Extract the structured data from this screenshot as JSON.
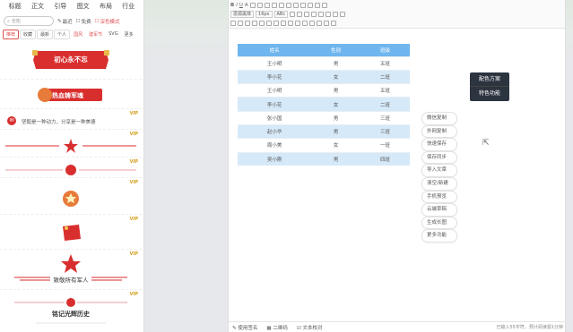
{
  "top_tabs": [
    "标题",
    "正文",
    "引导",
    "图文",
    "布局",
    "行业"
  ],
  "search": {
    "placeholder": "全拓",
    "opt1": "最近",
    "opt2": "免费",
    "opt3": "深色模式"
  },
  "filters": [
    "推荐",
    "收藏",
    "最新",
    "个人",
    "国风",
    "建军节",
    "SVG",
    "更多"
  ],
  "templates": {
    "t1": "初心永不忘",
    "t2": "热血铸军魂",
    "t3": "坚毅是一种动力，分享是一种美德",
    "t4": "致敬所有军人",
    "t5": "铭记光辉历史",
    "vip": "VIP"
  },
  "toolbar": {
    "font": "字体",
    "family": "思源黑体",
    "size": "16px",
    "size2": "ABc"
  },
  "table": {
    "headers": [
      "姓名",
      "性别",
      "班级"
    ],
    "rows": [
      [
        "王小明",
        "男",
        "五班"
      ],
      [
        "李小花",
        "女",
        "二班"
      ],
      [
        "王小明",
        "男",
        "五班"
      ],
      [
        "李小花",
        "女",
        "二班"
      ],
      [
        "张小国",
        "男",
        "三班"
      ],
      [
        "赵小华",
        "男",
        "三班"
      ],
      [
        "周小美",
        "女",
        "一班"
      ],
      [
        "吴小刚",
        "男",
        "四班"
      ]
    ]
  },
  "status": {
    "s1": "使用签名",
    "s2": "二维码",
    "s3": "文本校对",
    "s4": "已输入55字符，预计阅读需1分钟"
  },
  "color_box": {
    "a": "配色方案",
    "b": "特色功能"
  },
  "side_menu": [
    "微信复制",
    "外网复制",
    "快速保存",
    "保存同步",
    "导入文章",
    "清空/新建",
    "手机预览",
    "云端草稿",
    "生成长图",
    "更多功能"
  ],
  "colors": {
    "accent": "#e05050",
    "table_head": "#6fb6ee",
    "table_alt": "#d6e9f8"
  }
}
